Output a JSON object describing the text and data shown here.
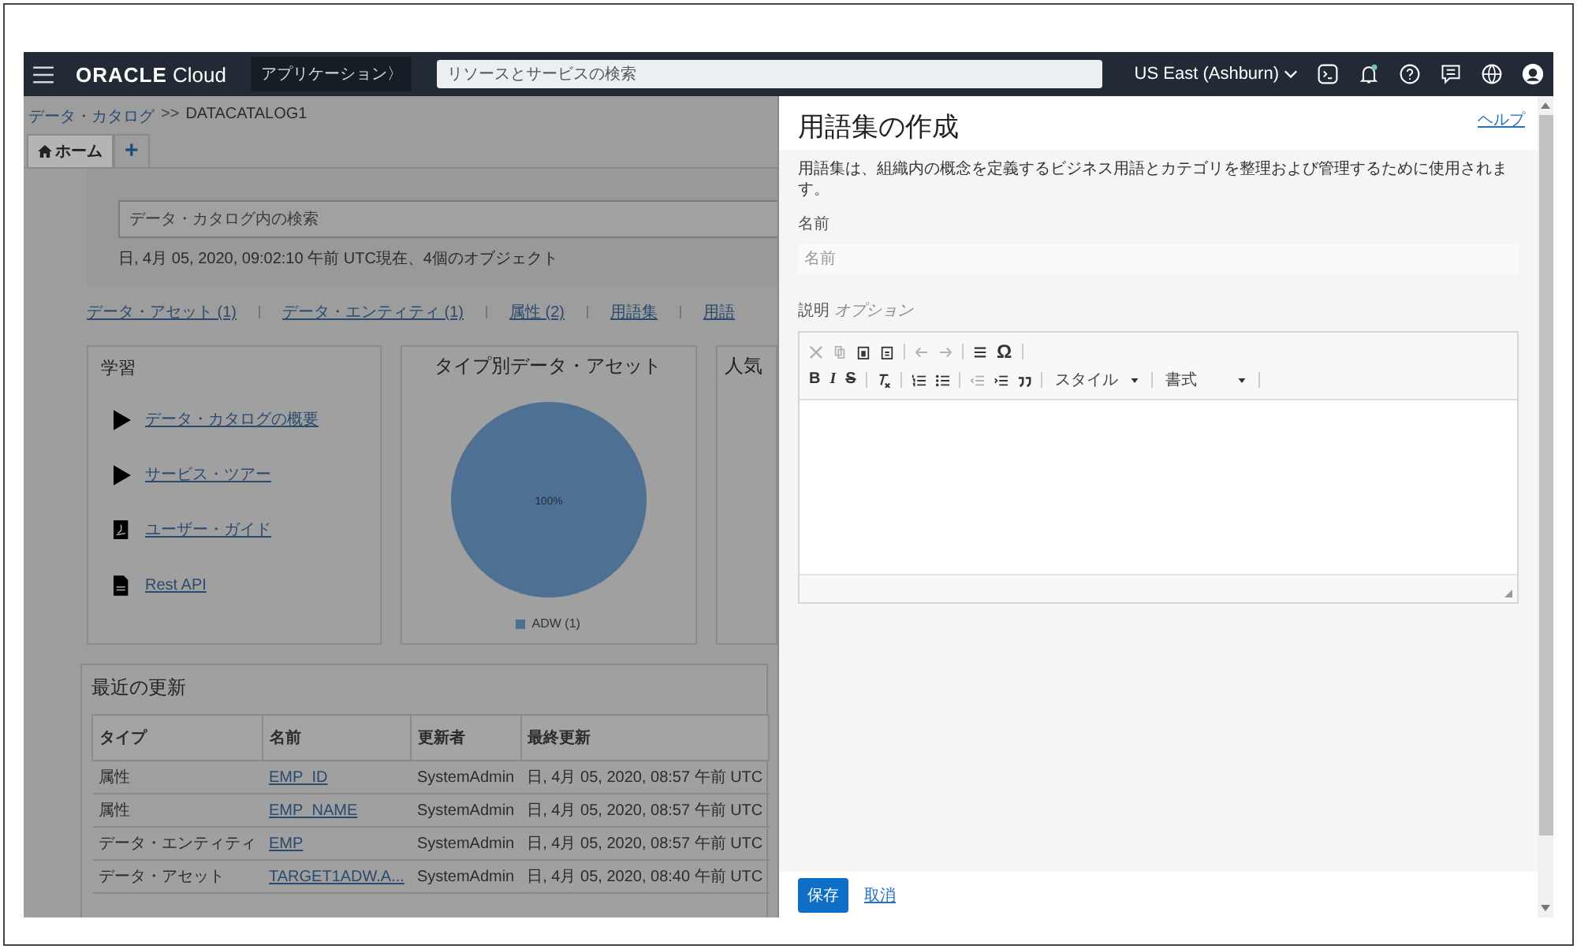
{
  "top_bar": {
    "brand": "ORACLE",
    "brand_suffix": "Cloud",
    "apps_button": "アプリケーション〉",
    "search": {
      "placeholder": "リソースとサービスの検索"
    },
    "region": "US East (Ashburn)"
  },
  "breadcrumb": {
    "link": "データ・カタログ",
    "separator": ">>",
    "current": "DATACATALOG1"
  },
  "tabs": [
    {
      "label": "ホーム",
      "kind": "home",
      "selected": true
    },
    {
      "label": "+",
      "kind": "add",
      "selected": false
    }
  ],
  "catalog_search": {
    "placeholder": "データ・カタログ内の検索",
    "info": "日, 4月 05, 2020, 09:02:10 午前 UTC現在、4個のオブジェクト"
  },
  "summary_links": [
    "データ・アセット (1)",
    "データ・エンティティ (1)",
    "属性 (2)",
    "用語集",
    "用語"
  ],
  "learning": {
    "title": "学習",
    "items": [
      {
        "label": "データ・カタログの概要",
        "kind": "video"
      },
      {
        "label": "サービス・ツアー",
        "kind": "video"
      },
      {
        "label": "ユーザー・ガイド",
        "kind": "pdf"
      },
      {
        "label": "Rest API",
        "kind": "doc"
      }
    ]
  },
  "assets_by_type": {
    "title": "タイプ別データ・アセット",
    "pie_label": "100%",
    "legend": [
      "ADW (1)"
    ]
  },
  "popular": {
    "title": "人気"
  },
  "recent": {
    "title": "最近の更新",
    "columns": [
      "タイプ",
      "名前",
      "更新者",
      "最終更新"
    ],
    "rows": [
      {
        "type": "属性",
        "name": "EMP_ID",
        "updated_by": "SystemAdmin",
        "updated": "日, 4月 05, 2020, 08:57 午前 UTC"
      },
      {
        "type": "属性",
        "name": "EMP_NAME",
        "updated_by": "SystemAdmin",
        "updated": "日, 4月 05, 2020, 08:57 午前 UTC"
      },
      {
        "type": "データ・エンティティ",
        "name": "EMP",
        "updated_by": "SystemAdmin",
        "updated": "日, 4月 05, 2020, 08:57 午前 UTC"
      },
      {
        "type": "データ・アセット",
        "name": "TARGET1ADW.A...",
        "updated_by": "SystemAdmin",
        "updated": "日, 4月 05, 2020, 08:40 午前 UTC"
      }
    ]
  },
  "panel": {
    "title": "用語集の作成",
    "help": "ヘルプ",
    "description": "用語集は、組織内の概念を定義するビジネス用語とカテゴリを整理および管理するために使用されます。",
    "name_label": "名前",
    "name_placeholder": "名前",
    "desc_label": "説明",
    "desc_optional": "オプション",
    "editor": {
      "cut": {
        "disabled": true
      },
      "copy": {
        "disabled": true
      },
      "paste": {
        "disabled": false
      },
      "paste_text": {
        "disabled": false
      },
      "undo": {
        "disabled": true
      },
      "redo": {
        "disabled": true
      },
      "outdent": {
        "disabled": true
      },
      "special_char": "Ω",
      "bold": "B",
      "italic": "I",
      "strike": "S",
      "styles": "スタイル",
      "format": "書式"
    },
    "save": "保存",
    "cancel": "取消"
  }
}
